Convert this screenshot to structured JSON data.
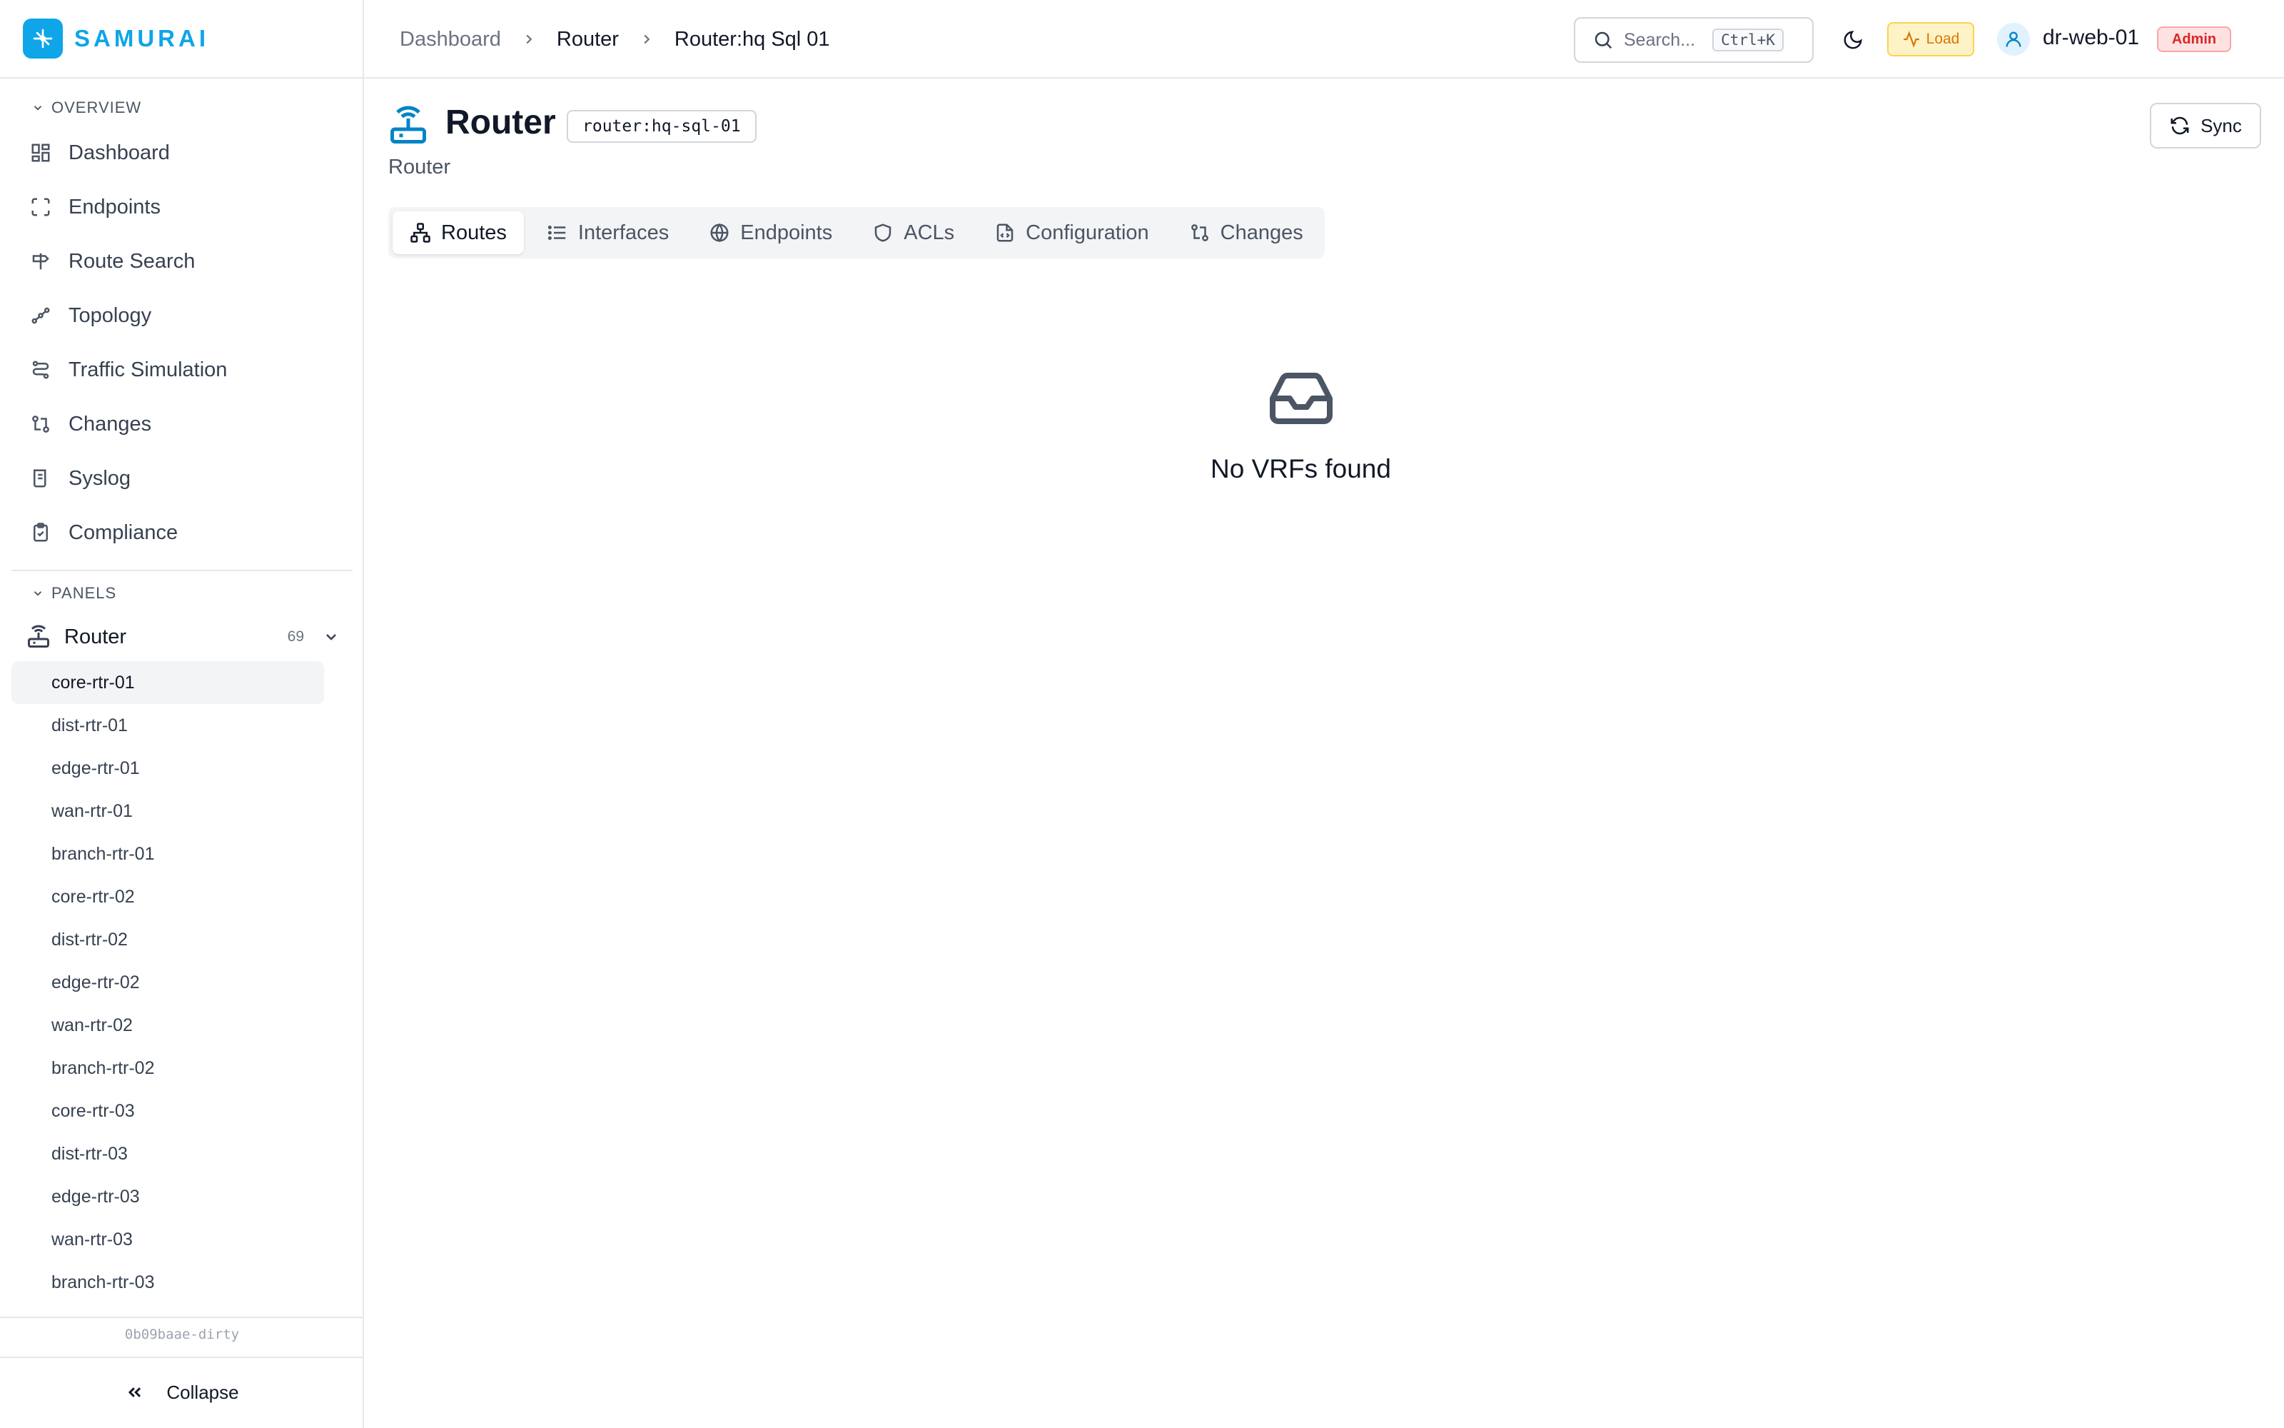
{
  "brand": {
    "name": "SAMURAI"
  },
  "sidebar": {
    "overview_label": "OVERVIEW",
    "nav": [
      {
        "label": "Dashboard",
        "icon": "dashboard-icon"
      },
      {
        "label": "Endpoints",
        "icon": "endpoints-icon"
      },
      {
        "label": "Route Search",
        "icon": "signpost-icon"
      },
      {
        "label": "Topology",
        "icon": "topology-icon"
      },
      {
        "label": "Traffic Simulation",
        "icon": "traffic-icon"
      },
      {
        "label": "Changes",
        "icon": "git-compare-icon"
      },
      {
        "label": "Syslog",
        "icon": "scroll-icon"
      },
      {
        "label": "Compliance",
        "icon": "clipboard-check-icon"
      }
    ],
    "panels_label": "PANELS",
    "panel": {
      "label": "Router",
      "count": "69"
    },
    "routers": [
      "core-rtr-01",
      "dist-rtr-01",
      "edge-rtr-01",
      "wan-rtr-01",
      "branch-rtr-01",
      "core-rtr-02",
      "dist-rtr-02",
      "edge-rtr-02",
      "wan-rtr-02",
      "branch-rtr-02",
      "core-rtr-03",
      "dist-rtr-03",
      "edge-rtr-03",
      "wan-rtr-03",
      "branch-rtr-03"
    ],
    "active_router": "core-rtr-01",
    "version": "0b09baae-dirty",
    "collapse_label": "Collapse"
  },
  "topbar": {
    "breadcrumbs": [
      "Dashboard",
      "Router",
      "Router:hq Sql 01"
    ],
    "search_placeholder": "Search...",
    "search_shortcut": "Ctrl+K",
    "load_label": "Load",
    "user_name": "dr-web-01",
    "role": "Admin"
  },
  "page": {
    "title": "Router",
    "id_badge": "router:hq-sql-01",
    "subtitle": "Router",
    "sync_label": "Sync",
    "tabs": [
      {
        "label": "Routes",
        "active": true
      },
      {
        "label": "Interfaces",
        "active": false
      },
      {
        "label": "Endpoints",
        "active": false
      },
      {
        "label": "ACLs",
        "active": false
      },
      {
        "label": "Configuration",
        "active": false
      },
      {
        "label": "Changes",
        "active": false
      }
    ],
    "empty_message": "No VRFs found"
  },
  "colors": {
    "accent": "#0ea5e9",
    "load_badge": "#d97706",
    "admin_badge": "#dc2626"
  }
}
